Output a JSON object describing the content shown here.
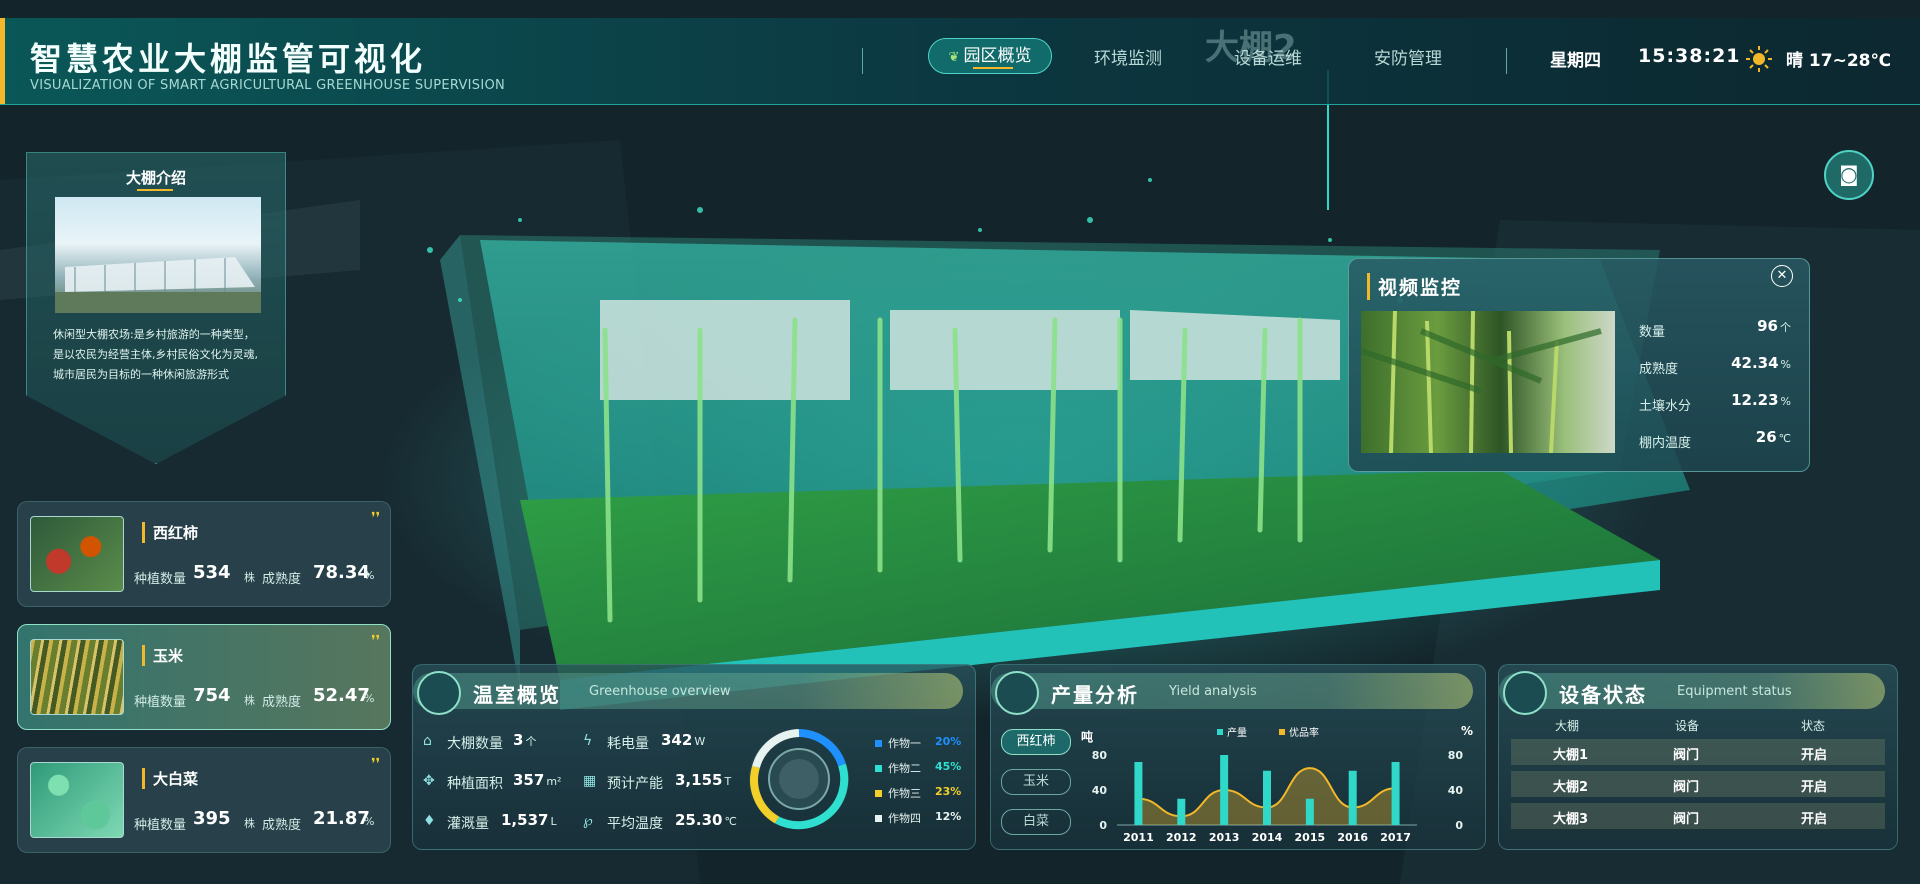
{
  "header": {
    "title_cn": "智慧农业大棚监管可视化",
    "title_en": "VISUALIZATION OF SMART AGRICULTURAL GREENHOUSE SUPERVISION",
    "nav": [
      "园区概览",
      "环境监测",
      "设备运维",
      "安防管理"
    ],
    "active_nav": "园区概览",
    "weekday": "星期四",
    "time": "15:38:21",
    "weather": "晴 17~28℃",
    "weather_icon": "sun-icon",
    "scene_label": "大棚2"
  },
  "intro": {
    "title": "大棚介绍",
    "text": "休闲型大棚农场:是乡村旅游的一种类型，是以农民为经营主体,乡村民俗文化为灵魂,城市居民为目标的一种休闲旅游形式"
  },
  "crops": [
    {
      "name": "西红柿",
      "count_label": "种植数量",
      "count": "534",
      "count_unit": "株",
      "ripe_label": "成熟度",
      "ripe": "78.34",
      "ripe_unit": "%"
    },
    {
      "name": "玉米",
      "count_label": "种植数量",
      "count": "754",
      "count_unit": "株",
      "ripe_label": "成熟度",
      "ripe": "52.47",
      "ripe_unit": "%"
    },
    {
      "name": "大白菜",
      "count_label": "种植数量",
      "count": "395",
      "count_unit": "株",
      "ripe_label": "成熟度",
      "ripe": "21.87",
      "ripe_unit": "%"
    }
  ],
  "video": {
    "title": "视频监控",
    "rows": [
      {
        "label": "数量",
        "value": "96",
        "unit": "个"
      },
      {
        "label": "成熟度",
        "value": "42.34",
        "unit": "%"
      },
      {
        "label": "土壤水分",
        "value": "12.23",
        "unit": "%"
      },
      {
        "label": "棚内温度",
        "value": "26",
        "unit": "℃"
      }
    ]
  },
  "greenhouse": {
    "title_cn": "温室概览",
    "title_en": "Greenhouse overview",
    "stats": [
      {
        "icon": "house-icon",
        "label": "大棚数量",
        "value": "3",
        "unit": "个"
      },
      {
        "icon": "lightning-icon",
        "label": "耗电量",
        "value": "342",
        "unit": "W"
      },
      {
        "icon": "area-icon",
        "label": "种植面积",
        "value": "357",
        "unit": "m²"
      },
      {
        "icon": "output-icon",
        "label": "预计产能",
        "value": "3,155",
        "unit": "T"
      },
      {
        "icon": "water-drop-icon",
        "label": "灌溉量",
        "value": "1,537",
        "unit": "L"
      },
      {
        "icon": "thermometer-icon",
        "label": "平均温度",
        "value": "25.30",
        "unit": "℃"
      }
    ],
    "crops_legend": [
      {
        "name": "作物一",
        "pct": "20%",
        "color": "#1e90ff"
      },
      {
        "name": "作物二",
        "pct": "45%",
        "color": "#2fe0d0"
      },
      {
        "name": "作物三",
        "pct": "23%",
        "color": "#f2d029"
      },
      {
        "name": "作物四",
        "pct": "12%",
        "color": "#e6f3f0"
      }
    ]
  },
  "yield": {
    "title_cn": "产量分析",
    "title_en": "Yield analysis",
    "tabs": [
      "西红柿",
      "玉米",
      "白菜"
    ],
    "active_tab": "西红柿"
  },
  "chart_data": {
    "type": "bar",
    "categories": [
      "2011",
      "2012",
      "2013",
      "2014",
      "2015",
      "2016",
      "2017"
    ],
    "series": [
      {
        "name": "产量",
        "type": "bar",
        "values": [
          72,
          30,
          80,
          62,
          30,
          62,
          72
        ],
        "color": "#2fd8c8"
      },
      {
        "name": "优品率",
        "type": "line",
        "values": [
          30,
          10,
          40,
          20,
          65,
          20,
          42
        ],
        "color": "#f2b829"
      }
    ],
    "ylabel_left": "吨",
    "ylabel_right": "%",
    "ylim": [
      0,
      80
    ],
    "yticks": [
      0,
      40,
      80
    ],
    "grid": false,
    "legend_position": "top"
  },
  "device": {
    "title_cn": "设备状态",
    "title_en": "Equipment status",
    "headers": [
      "大棚",
      "设备",
      "状态"
    ],
    "rows": [
      [
        "大棚1",
        "阀门",
        "开启"
      ],
      [
        "大棚2",
        "阀门",
        "开启"
      ],
      [
        "大棚3",
        "阀门",
        "开启"
      ]
    ]
  }
}
